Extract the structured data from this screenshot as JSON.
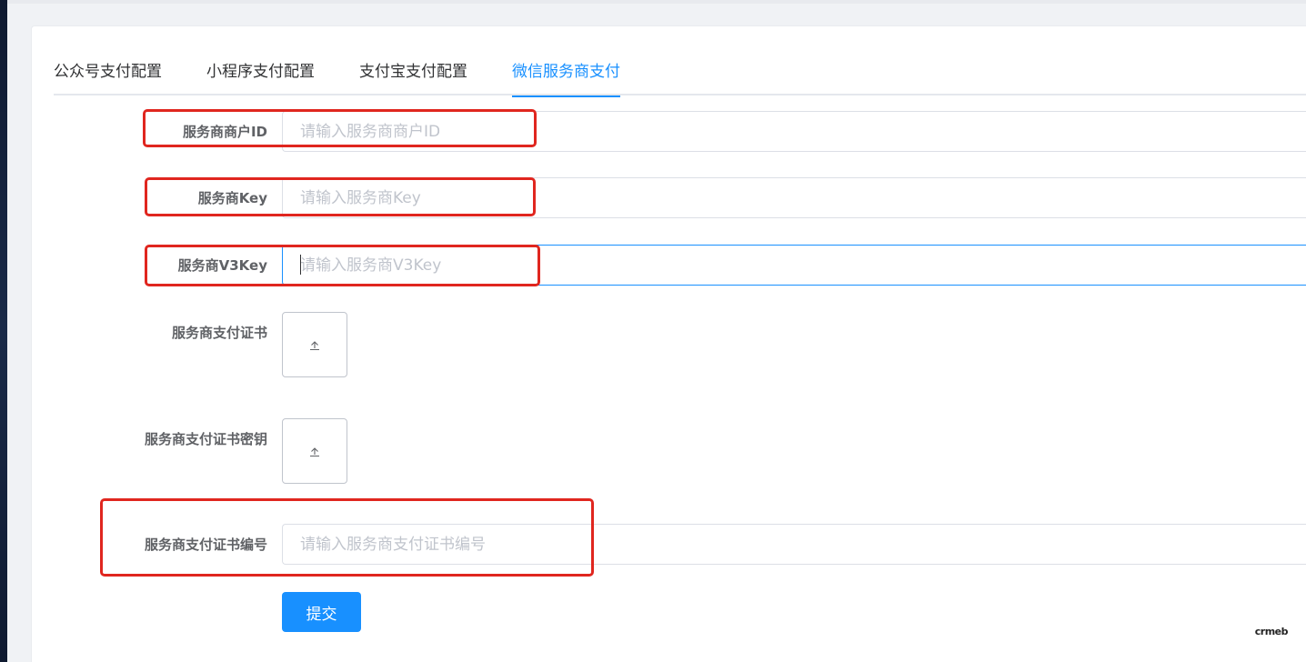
{
  "tabs": [
    {
      "label": "公众号支付配置",
      "active": false
    },
    {
      "label": "小程序支付配置",
      "active": false
    },
    {
      "label": "支付宝支付配置",
      "active": false
    },
    {
      "label": "微信服务商支付",
      "active": true
    }
  ],
  "form": {
    "merchant_id": {
      "label": "服务商商户ID",
      "placeholder": "请输入服务商商户ID",
      "value": ""
    },
    "key": {
      "label": "服务商Key",
      "placeholder": "请输入服务商Key",
      "value": ""
    },
    "v3key": {
      "label": "服务商V3Key",
      "placeholder": "请输入服务商V3Key",
      "value": ""
    },
    "cert": {
      "label": "服务商支付证书"
    },
    "cert_key": {
      "label": "服务商支付证书密钥"
    },
    "cert_serial": {
      "label": "服务商支付证书编号",
      "placeholder": "请输入服务商支付证书编号",
      "value": ""
    },
    "submit_label": "提交"
  },
  "icons": {
    "upload": "upload-icon"
  },
  "colors": {
    "accent": "#1890ff",
    "highlight": "#e0261f"
  },
  "watermark": "crmeb"
}
